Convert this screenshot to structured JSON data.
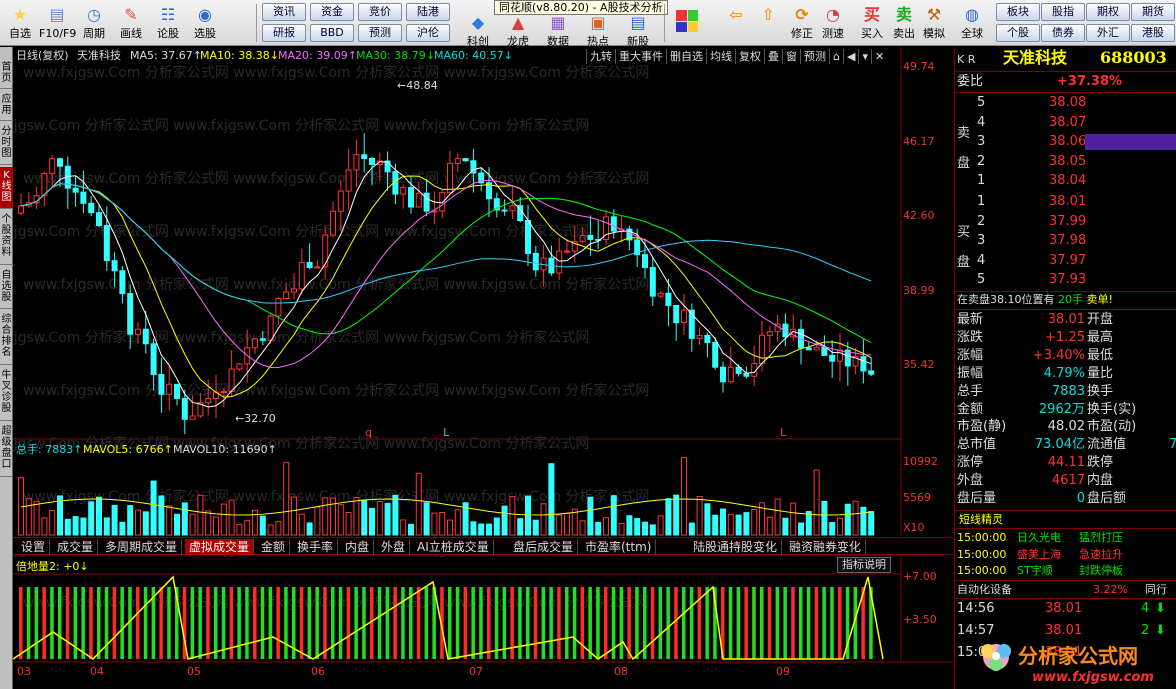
{
  "window": {
    "title": "同花顺(v8.80.20) - A股技术分析"
  },
  "toolbar": {
    "items": [
      {
        "label": "自选",
        "icon": "star-icon"
      },
      {
        "label": "F10/F9",
        "icon": "f10-icon"
      },
      {
        "label": "周期",
        "icon": "clock-icon"
      },
      {
        "label": "画线",
        "icon": "pencil-icon"
      },
      {
        "label": "论股",
        "icon": "discuss-icon"
      },
      {
        "label": "选股",
        "icon": "chart-pick-icon"
      }
    ],
    "buttons_row1": [
      "资讯",
      "资金",
      "竞价",
      "陆港"
    ],
    "buttons_row2": [
      "研报",
      "BBD",
      "预测",
      "沪伦"
    ],
    "items2": [
      {
        "label": "科创",
        "icon": "kechuang-icon"
      },
      {
        "label": "龙虎",
        "icon": "longhu-icon"
      },
      {
        "label": "数据",
        "icon": "data-grid-icon"
      },
      {
        "label": "热点",
        "icon": "hot-icon"
      },
      {
        "label": "新股",
        "icon": "ipo-icon"
      }
    ],
    "items3": [
      {
        "label": "后退",
        "icon": "back-arrow-icon"
      },
      {
        "label": "前进",
        "icon": "forward-arrow-icon"
      },
      {
        "label": "修正",
        "icon": "correct-icon"
      },
      {
        "label": "测速",
        "icon": "speed-icon"
      },
      {
        "label": "买入",
        "icon": "buy-icon"
      },
      {
        "label": "卖出",
        "icon": "sell-icon"
      },
      {
        "label": "模拟",
        "icon": "hammer-icon"
      },
      {
        "label": "全球",
        "icon": "globe-icon"
      }
    ],
    "right_row1": [
      "板块",
      "股指",
      "期权",
      "期货"
    ],
    "right_row2": [
      "个股",
      "债券",
      "外汇",
      "港股"
    ]
  },
  "sidebar": {
    "tabs": [
      "首页",
      "应用",
      "分时图",
      "K线图",
      "个股资料",
      "自选股",
      "综合排名",
      "牛叉诊股",
      "超级盘口"
    ]
  },
  "chart": {
    "header": {
      "period": "日线(复权)",
      "name": "天准科技",
      "ma5": "MA5: 37.67↑",
      "ma10": "MA10: 38.38↓",
      "ma20": "MA20: 39.09↑",
      "ma30": "MA30: 38.79↓",
      "ma60": "MA60: 40.57↓"
    },
    "tools": [
      "九转",
      "重大事件",
      "删自选",
      "均线",
      "复权",
      "叠",
      "窗",
      "预测",
      "⌂",
      "◀",
      "▾",
      "✕"
    ],
    "watermark": "www.fxjgsw.Com 分析家公式网",
    "price_axis": [
      "49.74",
      "46.17",
      "42.60",
      "38.99",
      "35.42"
    ],
    "annotations": {
      "high": "48.84",
      "low": "32.70"
    },
    "markers": [
      "q",
      "L",
      "L"
    ],
    "volume_header": {
      "total": "总手: 7883↑",
      "mavol5": "MAVOL5: 6766↑",
      "mavol10": "MAVOL10: 11690↑"
    },
    "volume_axis": [
      "10992",
      "5569",
      "X10"
    ],
    "indicator_tabs": [
      "设置",
      "成交量",
      "多周期成交量",
      "虚拟成交量",
      "金额",
      "换手率",
      "内盘",
      "外盘",
      "AI立桩成交量",
      "盘后成交量",
      "市盈率(ttm)",
      "陆股通持股变化",
      "融资融券变化"
    ],
    "active_indicator": "虚拟成交量",
    "indicator_header": "倍地量2: +0↓",
    "indicator_button": "指标说明",
    "indicator_axis": [
      "+7.00",
      "+3.50"
    ],
    "x_axis": [
      "03",
      "04",
      "05",
      "06",
      "07",
      "08",
      "09"
    ]
  },
  "panel": {
    "market": "K R",
    "stock_name": "天准科技",
    "code": "688003",
    "weibi_label": "委比",
    "weibi_value": "+37.38%",
    "sell_label": "卖盘",
    "buy_label": "买盘",
    "asks": [
      {
        "level": "5",
        "price": "38.08"
      },
      {
        "level": "4",
        "price": "38.07"
      },
      {
        "level": "3",
        "price": "38.06"
      },
      {
        "level": "2",
        "price": "38.05"
      },
      {
        "level": "1",
        "price": "38.04"
      }
    ],
    "bids": [
      {
        "level": "1",
        "price": "38.01"
      },
      {
        "level": "2",
        "price": "37.99"
      },
      {
        "level": "3",
        "price": "37.98"
      },
      {
        "level": "4",
        "price": "37.97"
      },
      {
        "level": "5",
        "price": "37.93"
      }
    ],
    "notice": {
      "text": "在卖盘38.10位置有",
      "qty": "20手",
      "tag": "卖单!"
    },
    "stats_left": [
      {
        "label": "最新",
        "value": "38.01",
        "color": "red"
      },
      {
        "label": "涨跌",
        "value": "+1.25",
        "color": "red"
      },
      {
        "label": "涨幅",
        "value": "+3.40%",
        "color": "red"
      },
      {
        "label": "振幅",
        "value": "4.79%",
        "color": "cyan"
      },
      {
        "label": "总手",
        "value": "7883",
        "color": "cyan"
      },
      {
        "label": "金额",
        "value": "2962万",
        "color": "cyan"
      },
      {
        "label": "市盈(静)",
        "value": "48.02",
        "color": "white"
      },
      {
        "label": "总市值",
        "value": "73.04亿",
        "color": "cyan"
      },
      {
        "label": "涨停",
        "value": "44.11",
        "color": "red"
      },
      {
        "label": "外盘",
        "value": "4617",
        "color": "red"
      },
      {
        "label": "盘后量",
        "value": "0",
        "color": "cyan"
      }
    ],
    "stats_right": [
      "开盘",
      "最高",
      "最低",
      "量比",
      "换手",
      "换手(实)",
      "市盈(动)",
      "流通值",
      "跌停",
      "内盘",
      "盘后额"
    ],
    "stats_right_cut": "7",
    "elf_title": "短线精灵",
    "elf_rows": [
      {
        "time": "15:00:00",
        "stock": "日久光电",
        "event": "猛烈打压"
      },
      {
        "time": "15:00:00",
        "stock": "盛美上海",
        "event": "急速拉升"
      },
      {
        "time": "15:00:00",
        "stock": "ST宇顺",
        "event": "封跌停板"
      }
    ],
    "auto_label": "自动化设备",
    "auto_value": "3.22%",
    "auto_right": "同行",
    "ticks": [
      {
        "time": "14:56",
        "price": "38.01",
        "vol": "4",
        "dir": "down"
      },
      {
        "time": "14:57",
        "price": "38.01",
        "vol": "2",
        "dir": "down"
      },
      {
        "time": "15:00",
        "price": "38.01",
        "vol": "",
        "dir": ""
      }
    ],
    "logo_text": "分析家公式网",
    "logo_url": "www.fxjgsw.com"
  }
}
